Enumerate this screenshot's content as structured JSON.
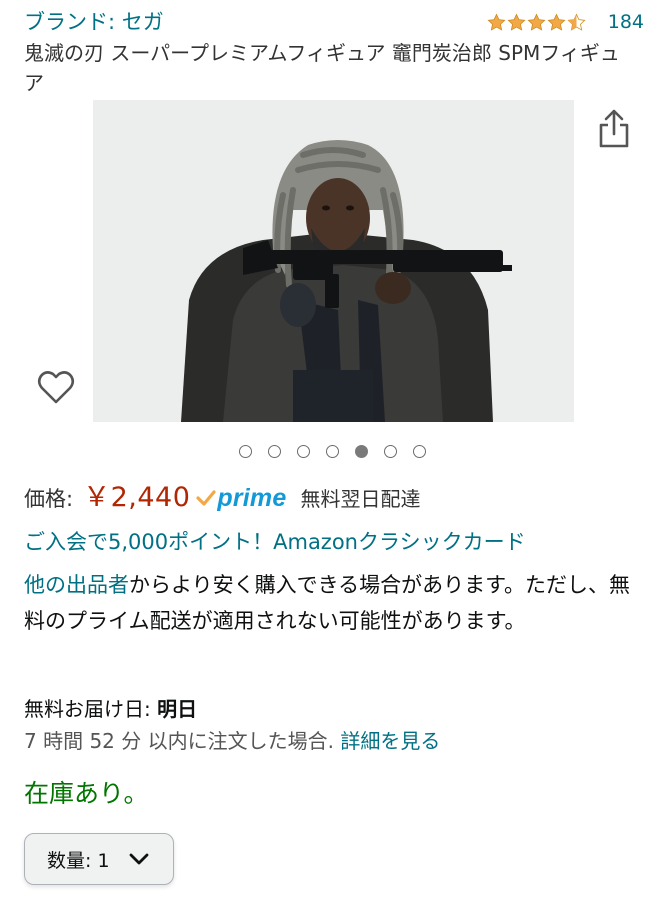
{
  "header": {
    "brand": "ブランド: セガ",
    "rating": 4.5,
    "review_count": "184",
    "title": "鬼滅の刃 スーパープレミアムフィギュア 竈門炭治郎 SPMフィギュア"
  },
  "gallery": {
    "image_count": 7,
    "active_index": 4,
    "image_alt": "Bearded man with grey dreadlocks aiming a rifle, wearing a dark coat",
    "share_icon": "share-icon",
    "wishlist_icon": "heart-icon"
  },
  "price": {
    "label": "価格:",
    "value": "￥2,440",
    "prime": "prime",
    "delivery_tag": "無料翌日配達"
  },
  "promo": "ご入会で5,000ポイント！Amazonクラシックカード",
  "sellers": {
    "link": "他の出品者",
    "text": "からより安く購入できる場合があります。ただし、無料のプライム配送が適用されない可能性があります。"
  },
  "delivery": {
    "label": "無料お届け日: ",
    "date": "明日",
    "cutoff": "7 時間 52 分 以内に注文した場合.",
    "details_link": "詳細を見る"
  },
  "stock": "在庫あり。",
  "quantity": {
    "label": "数量: 1"
  },
  "colors": {
    "link": "#007185",
    "price": "#b12704",
    "stock": "#007600",
    "star": "#f3a847",
    "prime": "#1399d8"
  }
}
